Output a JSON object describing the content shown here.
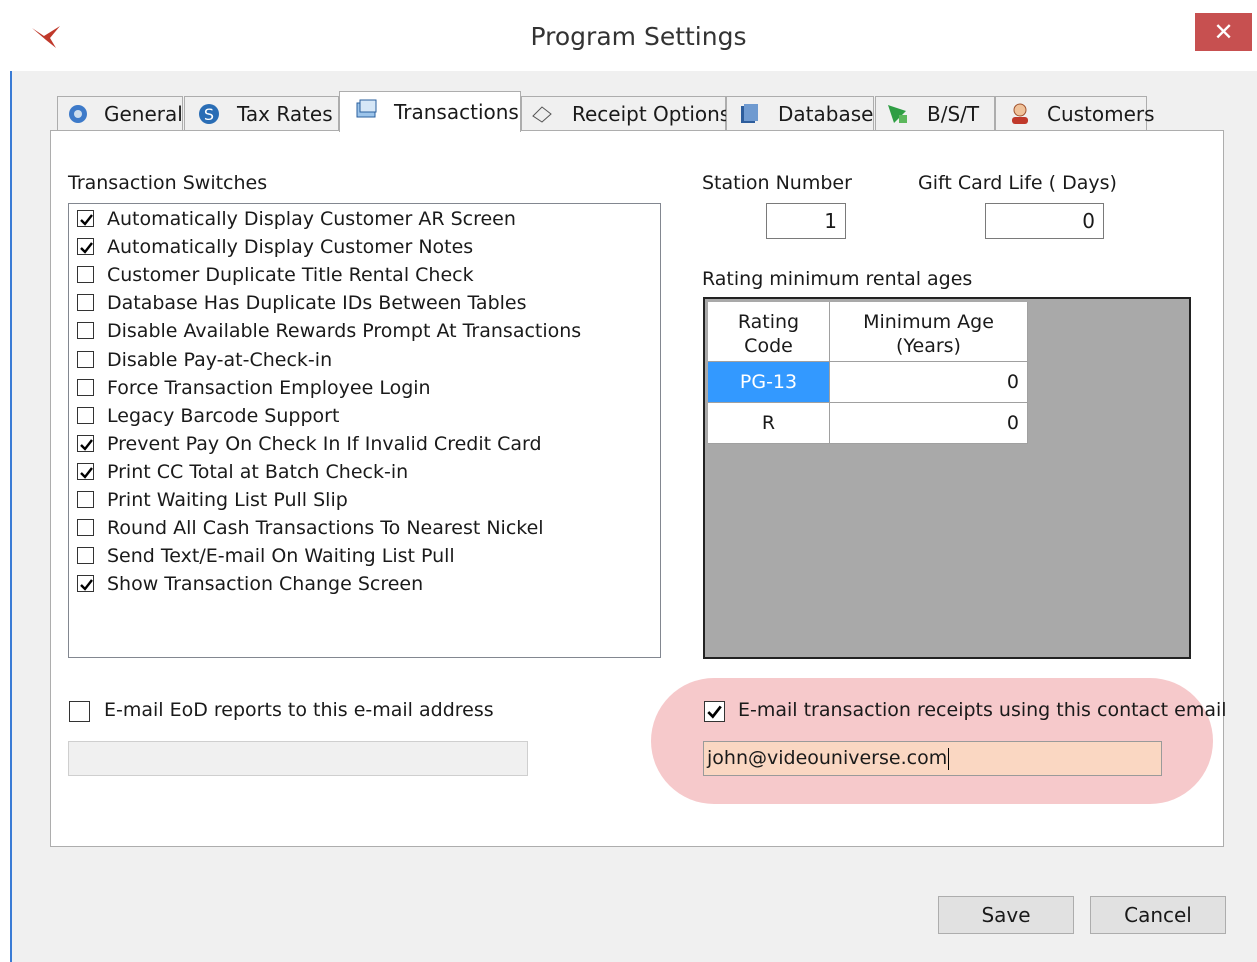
{
  "window": {
    "title": "Program Settings",
    "close_icon": "close-icon"
  },
  "tabs": [
    {
      "label": "General",
      "icon": "gear-globe-icon"
    },
    {
      "label": "Tax Rates",
      "icon": "dollar-icon"
    },
    {
      "label": "Transactions",
      "icon": "transactions-icon",
      "active": true
    },
    {
      "label": "Receipt Options",
      "icon": "receipt-icon"
    },
    {
      "label": "Database",
      "icon": "database-icon"
    },
    {
      "label": "B/S/T",
      "icon": "bst-icon"
    },
    {
      "label": "Customers",
      "icon": "customer-icon"
    }
  ],
  "switches": {
    "heading": "Transaction Switches",
    "items": [
      {
        "label": "Automatically Display Customer AR Screen",
        "checked": true
      },
      {
        "label": "Automatically Display Customer Notes",
        "checked": true
      },
      {
        "label": "Customer Duplicate Title Rental Check",
        "checked": false
      },
      {
        "label": "Database Has Duplicate IDs Between Tables",
        "checked": false
      },
      {
        "label": "Disable Available Rewards Prompt At Transactions",
        "checked": false
      },
      {
        "label": "Disable Pay-at-Check-in",
        "checked": false
      },
      {
        "label": "Force Transaction Employee Login",
        "checked": false
      },
      {
        "label": "Legacy Barcode Support",
        "checked": false
      },
      {
        "label": "Prevent Pay On Check In If Invalid Credit Card",
        "checked": true
      },
      {
        "label": "Print CC Total at Batch Check-in",
        "checked": true
      },
      {
        "label": "Print Waiting List Pull Slip",
        "checked": false
      },
      {
        "label": "Round All Cash Transactions To Nearest Nickel",
        "checked": false
      },
      {
        "label": "Send Text/E-mail On Waiting List Pull",
        "checked": false
      },
      {
        "label": "Show Transaction Change Screen",
        "checked": true
      }
    ]
  },
  "station": {
    "label": "Station Number",
    "value": "1"
  },
  "giftcard": {
    "label": "Gift Card Life ( Days)",
    "value": "0"
  },
  "ratings": {
    "heading": "Rating minimum rental ages",
    "col1_line1": "Rating",
    "col1_line2": "Code",
    "col2_line1": "Minimum Age",
    "col2_line2": "(Years)",
    "rows": [
      {
        "code": "PG-13",
        "age": "0",
        "selected": true
      },
      {
        "code": "R",
        "age": "0",
        "selected": false
      }
    ]
  },
  "eod": {
    "label": "E-mail EoD reports to this e-mail address",
    "checked": false,
    "value": ""
  },
  "receipts": {
    "label": "E-mail transaction receipts using this contact email",
    "checked": true,
    "value": "john@videouniverse.com"
  },
  "colors": {
    "selection": "#3399ff",
    "highlight": "#f6c9cb",
    "close": "#c75050"
  },
  "buttons": {
    "save": "Save",
    "cancel": "Cancel"
  }
}
